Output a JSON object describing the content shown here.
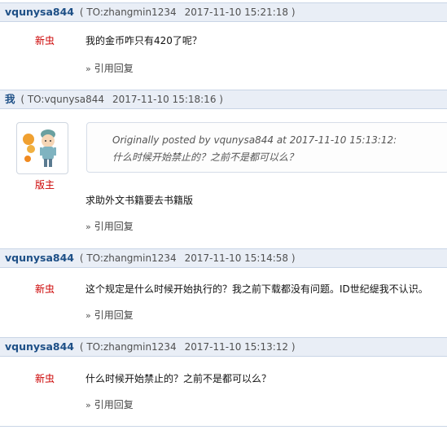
{
  "posts": [
    {
      "author": "vqunysa844",
      "to": "( TO:zhangmin1234",
      "time": "2017-11-10 15:21:18 )",
      "rank": "新虫",
      "content": "我的金币咋只有420了呢？",
      "reply": "引用回复"
    },
    {
      "author": "我",
      "to": "( TO:vqunysa844",
      "time": "2017-11-10 15:18:16 )",
      "rank": "版主",
      "quote_line1": "Originally posted by vqunysa844 at 2017-11-10 15:13:12:",
      "quote_line2": "什么时候开始禁止的？之前不是都可以么？",
      "content": "求助外文书籍要去书籍版",
      "reply": "引用回复"
    },
    {
      "author": "vqunysa844",
      "to": "( TO:zhangmin1234",
      "time": "2017-11-10 15:14:58 )",
      "rank": "新虫",
      "content": "这个规定是什么时候开始执行的？我之前下载都没有问题。ID世纪缇我不认识。",
      "reply": "引用回复"
    },
    {
      "author": "vqunysa844",
      "to": "( TO:zhangmin1234",
      "time": "2017-11-10 15:13:12 )",
      "rank": "新虫",
      "content": "什么时候开始禁止的？之前不是都可以么？",
      "reply": "引用回复"
    }
  ],
  "icons": {
    "reply_arrow": "»",
    "avatar": "cartoon-character-avatar"
  },
  "colors": {
    "author": "#1d4f86",
    "rank": "#cc0000",
    "header_bg": "#e9eef6"
  }
}
